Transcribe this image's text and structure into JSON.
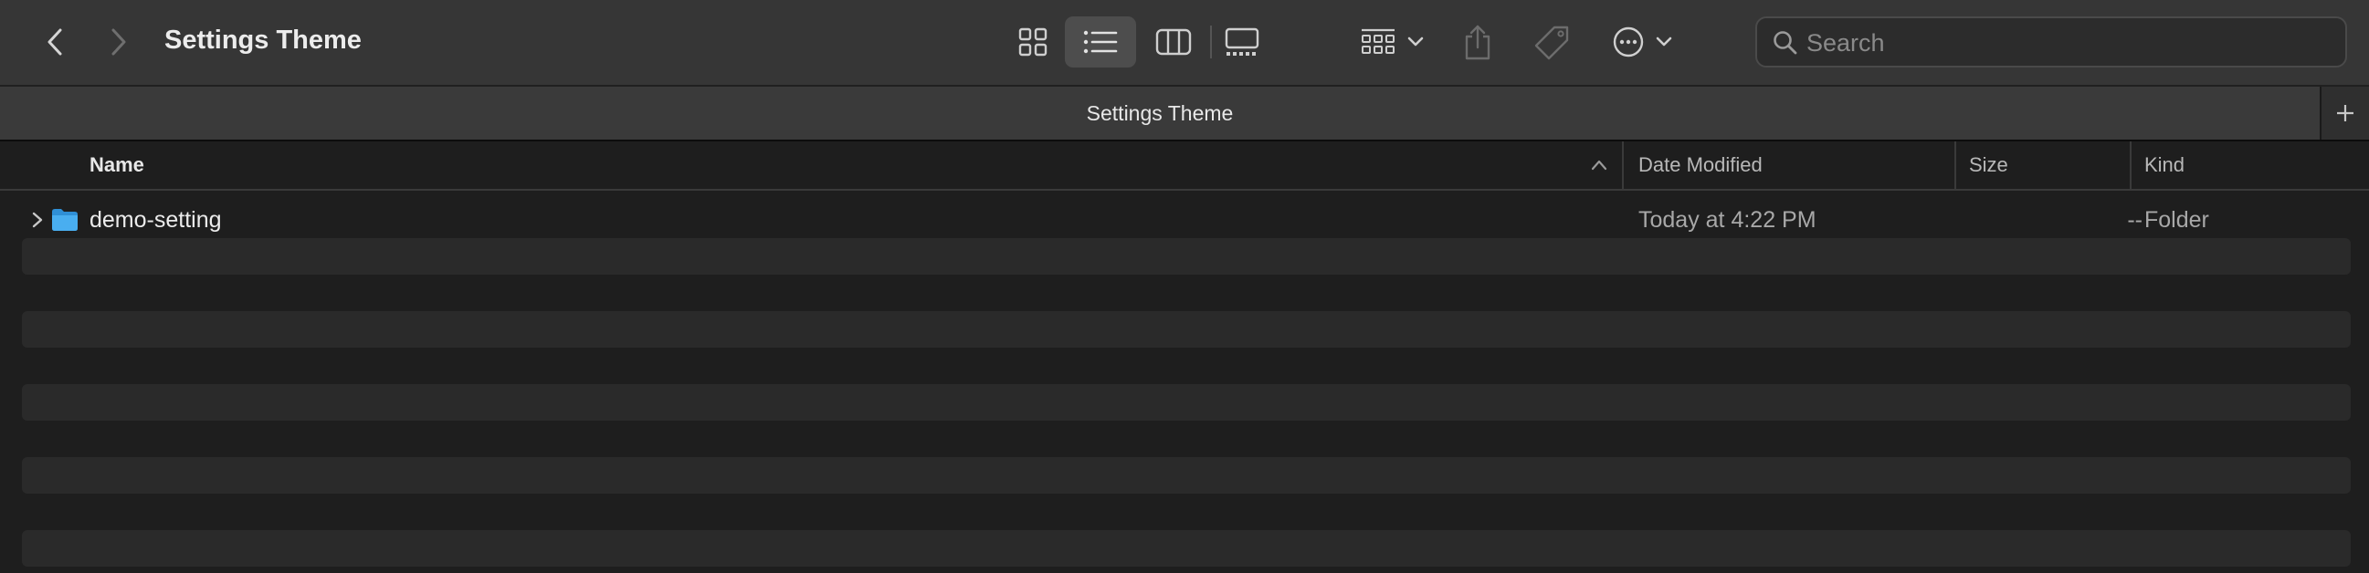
{
  "window": {
    "title": "Settings Theme"
  },
  "toolbar": {
    "back_icon": "chevron-left-icon",
    "forward_icon": "chevron-right-icon",
    "views": [
      "icon-view-icon",
      "list-view-icon",
      "column-view-icon",
      "gallery-view-icon"
    ],
    "active_view": "list",
    "group_icon": "group-by-icon",
    "share_icon": "share-icon",
    "tag_icon": "tag-icon",
    "more_icon": "ellipsis-circle-icon"
  },
  "search": {
    "placeholder": "Search",
    "value": ""
  },
  "tabs": [
    {
      "label": "Settings Theme",
      "active": true
    }
  ],
  "columns": {
    "name": "Name",
    "date_modified": "Date Modified",
    "size": "Size",
    "kind": "Kind",
    "sort_direction": "ascending"
  },
  "files": [
    {
      "name": "demo-setting",
      "date_modified": "Today at 4:22 PM",
      "size": "--",
      "kind": "Folder",
      "icon": "folder-icon"
    }
  ],
  "colors": {
    "folder": "#3ea6ea",
    "toolbar_bg": "#363636",
    "list_bg": "#1e1e1e",
    "stripe": "#2a2a2a"
  }
}
